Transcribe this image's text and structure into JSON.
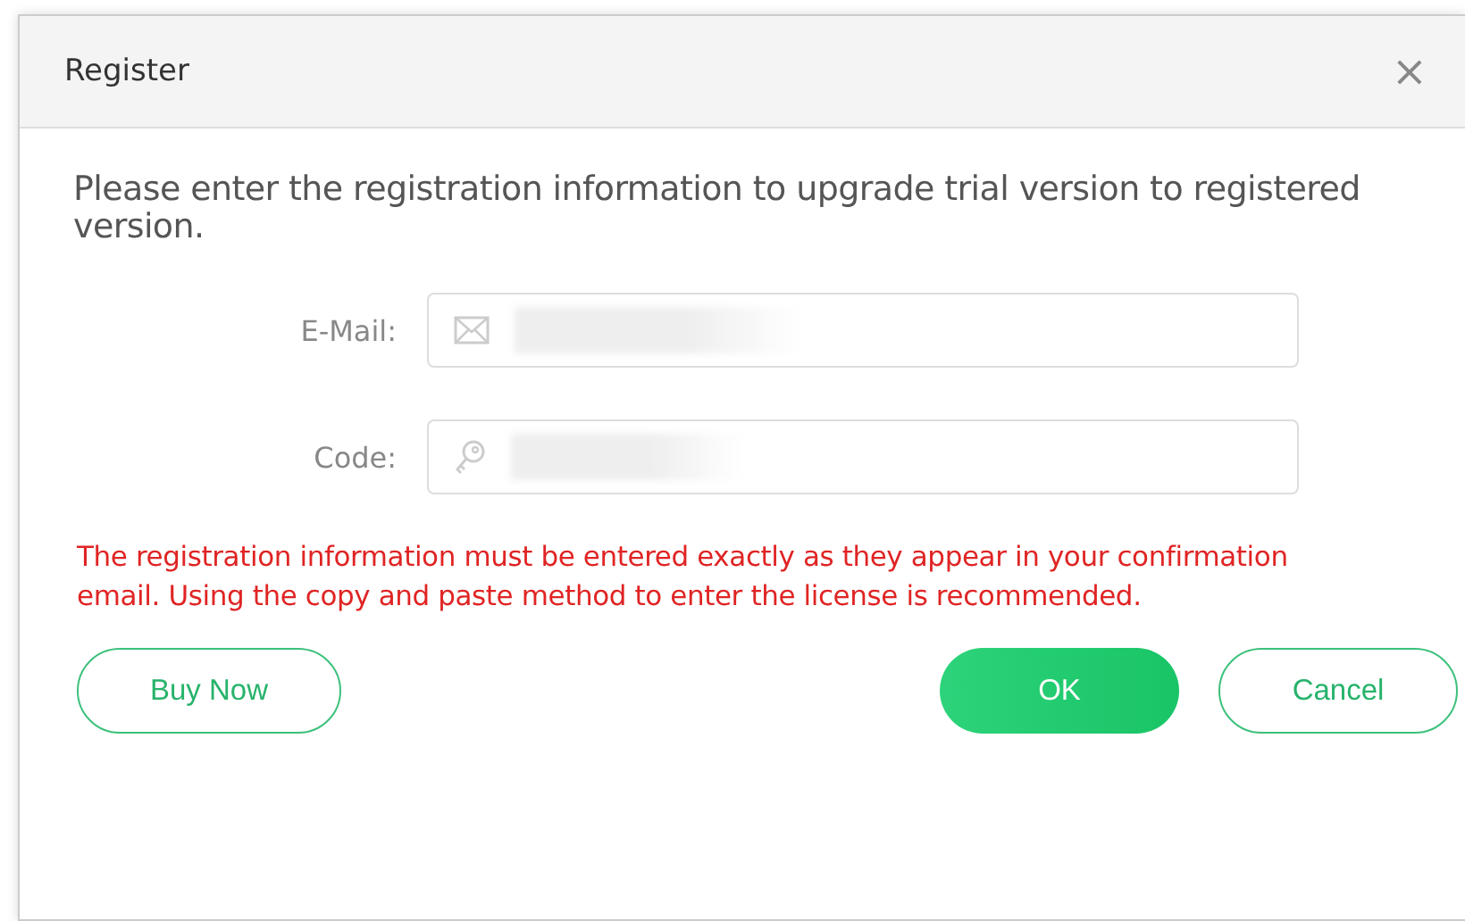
{
  "window": {
    "title": "Register",
    "close": "×"
  },
  "intro": "Please enter the registration information to upgrade trial version to registered version.",
  "fields": [
    {
      "kind": "email",
      "label": "E-Mail:"
    },
    {
      "kind": "code",
      "label": "Code:"
    }
  ],
  "notice": "The registration information must be entered exactly as they appear in your confirmation email. Using the copy and paste method to enter the license is recommended.",
  "buttons": {
    "buy": "Buy Now",
    "ok": "OK",
    "cancel": "Cancel"
  }
}
